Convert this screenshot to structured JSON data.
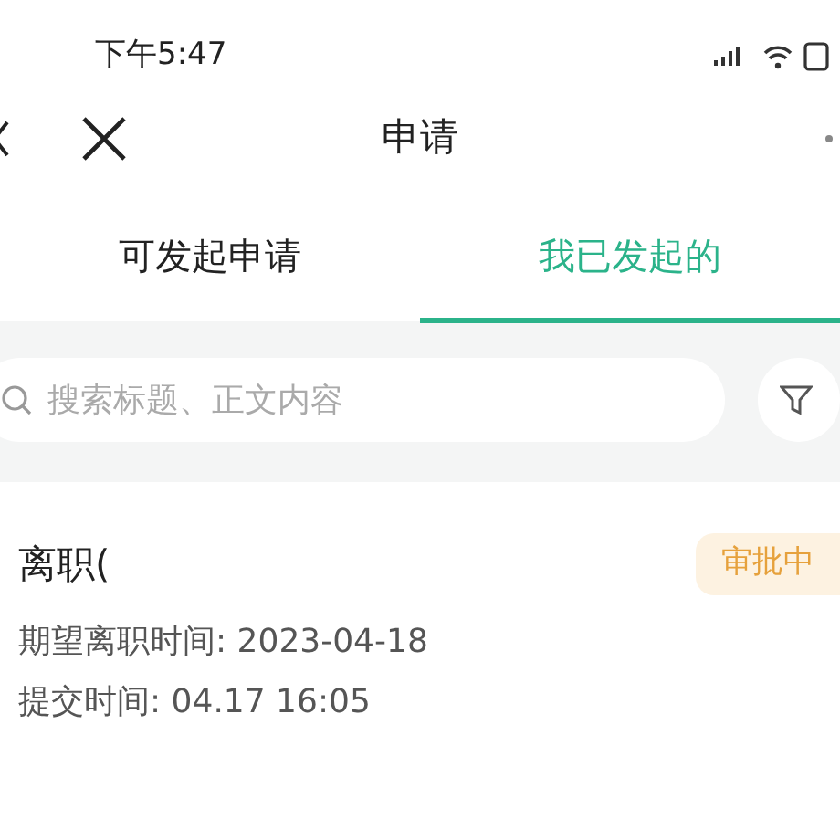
{
  "status_bar": {
    "time": "下午5:47"
  },
  "header": {
    "title": "申请"
  },
  "tabs": [
    {
      "label": "可发起申请",
      "selected": false
    },
    {
      "label": "我已发起的",
      "selected": true
    }
  ],
  "search": {
    "placeholder": "搜索标题、正文内容"
  },
  "requests": [
    {
      "title": "离职(",
      "status": "审批中",
      "lines": [
        "期望离职时间: 2023-04-18",
        "提交时间: 04.17 16:05"
      ]
    }
  ]
}
